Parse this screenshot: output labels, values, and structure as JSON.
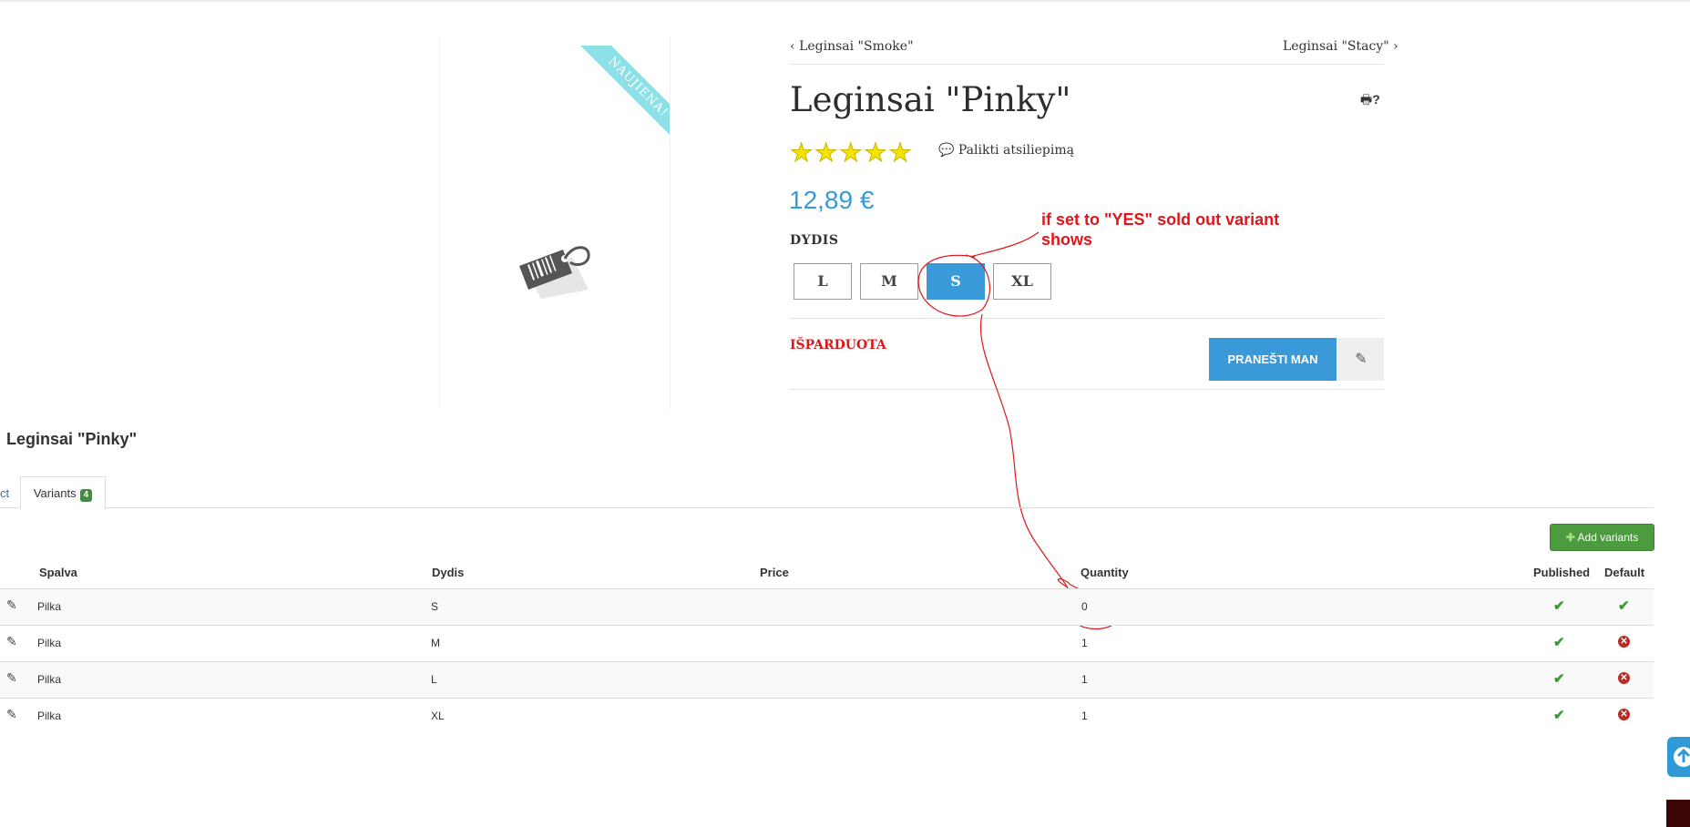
{
  "product": {
    "ribbon": "NAUJIENA!",
    "prev_link": "Leginsai \"Smoke\"",
    "next_link": "Leginsai \"Stacy\"",
    "title": "Leginsai \"Pinky\"",
    "print_help": "?",
    "stars": 5,
    "review_link": "Palikti atsiliepimą",
    "price": "12,89 €",
    "size_label": "DYDIS",
    "sizes": [
      "L",
      "M",
      "S",
      "XL"
    ],
    "selected_size": "S",
    "soldout_text": "IŠPARDUOTA",
    "notify_button": "PRANEŠTI MAN",
    "accent_color": "#3a9ad9"
  },
  "annotation": {
    "text": "if set to \"YES\" sold out variant shows",
    "color": "#e0161a"
  },
  "admin": {
    "title": "Leginsai \"Pinky\"",
    "prev_tab": "ct",
    "active_tab": "Variants",
    "variant_count": "4",
    "add_button": "Add variants",
    "columns": [
      "Spalva",
      "Dydis",
      "Price",
      "Quantity",
      "Published",
      "Default"
    ],
    "rows": [
      {
        "spalva": "Pilka",
        "dydis": "S",
        "price": "",
        "quantity": "0",
        "published": true,
        "default": true
      },
      {
        "spalva": "Pilka",
        "dydis": "M",
        "price": "",
        "quantity": "1",
        "published": true,
        "default": false
      },
      {
        "spalva": "Pilka",
        "dydis": "L",
        "price": "",
        "quantity": "1",
        "published": true,
        "default": false
      },
      {
        "spalva": "Pilka",
        "dydis": "XL",
        "price": "",
        "quantity": "1",
        "published": true,
        "default": false
      }
    ]
  }
}
